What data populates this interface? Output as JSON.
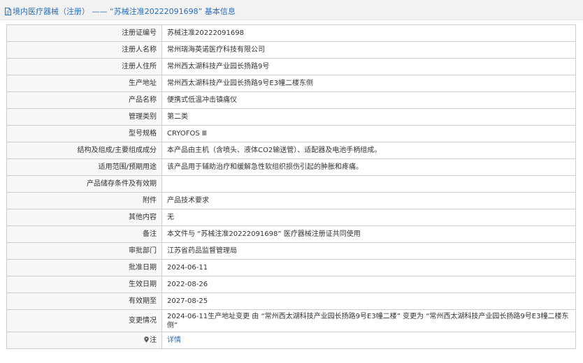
{
  "header": {
    "title": "境内医疗器械（注册） —— “苏械注准20222091698” 基本信息"
  },
  "rows": [
    {
      "key": "reg-number",
      "label": "注册证编号",
      "value": "苏械注准20222091698"
    },
    {
      "key": "registrant-name",
      "label": "注册人名称",
      "value": "常州瑞海英诺医疗科技有限公司"
    },
    {
      "key": "registrant-address",
      "label": "注册人住所",
      "value": "常州西太湖科技产业园长扬路9号"
    },
    {
      "key": "production-address",
      "label": "生产地址",
      "value": "常州西太湖科技产业园长扬路9号E3幢二楼东侧"
    },
    {
      "key": "product-name",
      "label": "产品名称",
      "value": "便携式低温冲击镇痛仪"
    },
    {
      "key": "management-category",
      "label": "管理类别",
      "value": "第二类"
    },
    {
      "key": "model-spec",
      "label": "型号规格",
      "value": "CRYOFOS Ⅲ"
    },
    {
      "key": "structure-composition",
      "label": "结构及组成/主要组成成分",
      "value": "本产品由主机（含喷头、液体CO2输送管）、适配器及电池手柄组成。"
    },
    {
      "key": "scope-of-use",
      "label": "适用范围/预期用途",
      "value": "该产品用于辅助治疗和缓解急性软组织损伤引起的肿胀和疼痛。"
    },
    {
      "key": "storage-conditions",
      "label": "产品储存条件及有效期",
      "value": ""
    },
    {
      "key": "attachment",
      "label": "附件",
      "value": "产品技术要求"
    },
    {
      "key": "other-content",
      "label": "其他内容",
      "value": "无"
    },
    {
      "key": "remarks",
      "label": "备注",
      "value": "本文件与 “苏械注准20222091698” 医疗器械注册证共同使用"
    },
    {
      "key": "approval-dept",
      "label": "审批部门",
      "value": "江苏省药品监督管理局"
    },
    {
      "key": "approval-date",
      "label": "批准日期",
      "value": "2024-06-11"
    },
    {
      "key": "effective-date",
      "label": "生效日期",
      "value": "2022-08-26"
    },
    {
      "key": "expiry-date",
      "label": "有效期至",
      "value": "2027-08-25"
    },
    {
      "key": "change-history",
      "label": "变更情况",
      "value": "2024-06-11生产地址变更 由 “常州西太湖科技产业园长扬路9号E3幢二楼” 变更为 “常州西太湖科技产业园长扬路9号E3幢二楼东侧”"
    }
  ],
  "note": {
    "label": "注",
    "link": "详情",
    "icon": "location-pin-icon"
  },
  "colors": {
    "accent": "#2a6fb5",
    "header_bg": "#f2f2f2",
    "label_bg": "#f7f7f7",
    "border": "#cfcfcf"
  }
}
